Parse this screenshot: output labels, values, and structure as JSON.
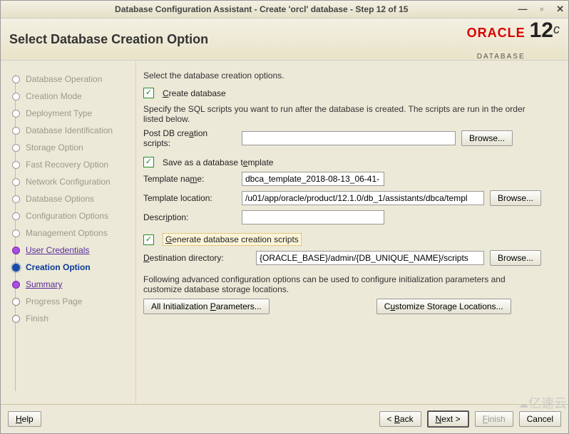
{
  "window": {
    "title": "Database Configuration Assistant - Create 'orcl' database - Step 12 of 15"
  },
  "header": {
    "page_title": "Select Database Creation Option",
    "brand_name": "ORACLE",
    "brand_sub": "DATABASE",
    "brand_version": "12",
    "brand_version_suffix": "c"
  },
  "steps": [
    {
      "label": "Database Operation",
      "state": "completed"
    },
    {
      "label": "Creation Mode",
      "state": "completed"
    },
    {
      "label": "Deployment Type",
      "state": "completed"
    },
    {
      "label": "Database Identification",
      "state": "completed"
    },
    {
      "label": "Storage Option",
      "state": "completed"
    },
    {
      "label": "Fast Recovery Option",
      "state": "completed"
    },
    {
      "label": "Network Configuration",
      "state": "completed"
    },
    {
      "label": "Database Options",
      "state": "completed"
    },
    {
      "label": "Configuration Options",
      "state": "completed"
    },
    {
      "label": "Management Options",
      "state": "completed"
    },
    {
      "label": "User Credentials",
      "state": "visited"
    },
    {
      "label": "Creation Option",
      "state": "current"
    },
    {
      "label": "Summary",
      "state": "visited"
    },
    {
      "label": "Progress Page",
      "state": "future"
    },
    {
      "label": "Finish",
      "state": "future"
    }
  ],
  "content": {
    "instruction": "Select the database creation options.",
    "create_db": {
      "label_pre": "C",
      "label_post": "reate database",
      "desc": "Specify the SQL scripts you want to run after the database is created. The scripts are run in the order listed below.",
      "post_scripts_label_pre": "Post DB cre",
      "post_scripts_label_ul": "a",
      "post_scripts_label_post": "tion scripts:",
      "post_scripts_value": "",
      "browse": "Browse..."
    },
    "save_template": {
      "label_pre": "Save as a database t",
      "label_ul": "e",
      "label_post": "mplate",
      "name_label_pre": "Template na",
      "name_label_ul": "m",
      "name_label_post": "e:",
      "name_value": "dbca_template_2018-08-13_06-41-",
      "location_label": "Template location:",
      "location_value": "/u01/app/oracle/product/12.1.0/db_1/assistants/dbca/templ",
      "browse2": "Browse...",
      "desc_label_pre": "Descr",
      "desc_label_ul": "i",
      "desc_label_post": "ption:",
      "desc_value": ""
    },
    "gen_scripts": {
      "label_ul": "G",
      "label_post": "enerate database creation scripts",
      "dest_label_ul": "D",
      "dest_label_post": "estination directory:",
      "dest_value": "{ORACLE_BASE}/admin/{DB_UNIQUE_NAME}/scripts",
      "browse3": "Browse..."
    },
    "advanced_note": "Following advanced configuration options can be used to configure initialization parameters and customize database storage locations.",
    "btn_init_params_pre": "All Initialization ",
    "btn_init_params_ul": "P",
    "btn_init_params_post": "arameters...",
    "btn_storage_pre": "C",
    "btn_storage_ul": "u",
    "btn_storage_post": "stomize Storage Locations..."
  },
  "footer": {
    "help": "Help",
    "back_pre": "< ",
    "back_ul": "B",
    "back_post": "ack",
    "next_ul": "N",
    "next_post": "ext >",
    "finish_ul": "F",
    "finish_post": "inish",
    "cancel": "Cancel"
  },
  "watermark": "亿速云"
}
